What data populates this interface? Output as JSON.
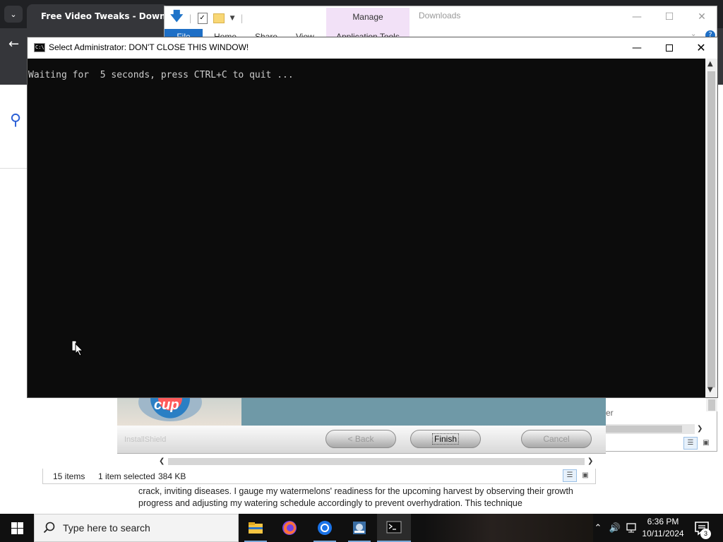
{
  "browser": {
    "tab_title": "Free Video Tweaks - Download",
    "article_text": "crack, inviting diseases. I gauge my watermelons' readiness for the upcoming harvest by observing their growth progress and adjusting my watering schedule accordingly to prevent overhydration. This technique"
  },
  "explorer": {
    "manage_label": "Manage",
    "title": "Downloads",
    "ribbon_tabs": {
      "file": "File",
      "home": "Home",
      "share": "Share",
      "view": "View",
      "app_tools": "Application Tools"
    },
    "status": {
      "items": "15 items",
      "selected": "1 item selected",
      "size": "384 KB"
    },
    "partial_label": "er"
  },
  "installshield": {
    "banner_text": "cup",
    "brand": "InstallShield",
    "back_label": "< Back",
    "finish_label": "Finish",
    "cancel_label": "Cancel"
  },
  "cmd": {
    "title": "Select Administrator:  DON'T CLOSE THIS WINDOW!",
    "icon_text": "C:\\",
    "output": "Waiting for  5 seconds, press CTRL+C to quit ..."
  },
  "taskbar": {
    "search_placeholder": "Type here to search",
    "time": "6:36 PM",
    "date": "10/11/2024",
    "notification_count": "3",
    "apps": [
      "file-explorer",
      "firefox",
      "chrome",
      "installer",
      "command-prompt"
    ]
  }
}
